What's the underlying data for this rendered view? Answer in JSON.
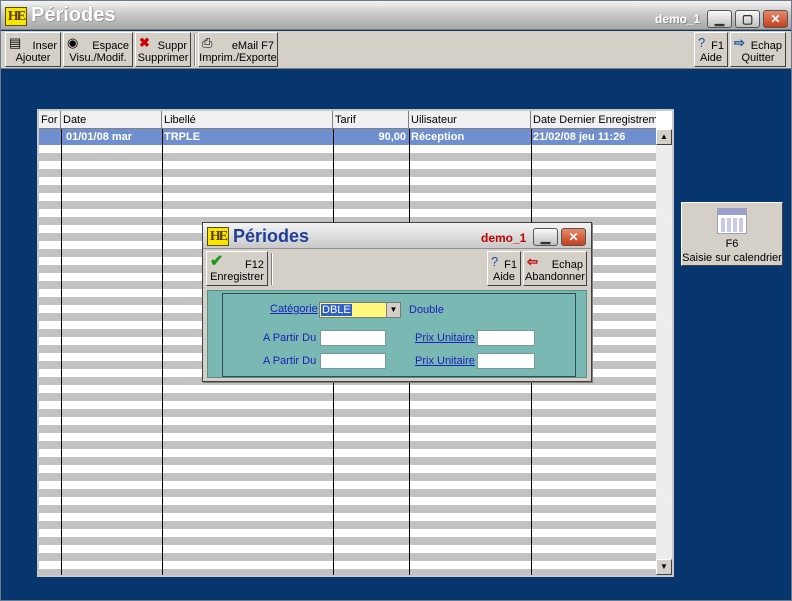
{
  "window": {
    "title": "Périodes",
    "user": "demo_1",
    "logo_text": "HE"
  },
  "toolbar": {
    "inser_key": "Inser",
    "inser_label": "Ajouter",
    "espace_key": "Espace",
    "espace_label": "Visu./Modif.",
    "suppr_key": "Suppr",
    "suppr_label": "Supprimer",
    "email_key": "eMail  F7",
    "email_label": "Imprim./Exporte",
    "aide_key": "F1",
    "aide_label": "Aide",
    "quit_key": "Echap",
    "quit_label": "Quitter"
  },
  "grid": {
    "columns": [
      "For",
      "Date",
      "Libellé",
      "Tarif",
      "Uilisateur",
      "Date Dernier Enregistrem"
    ],
    "rows": [
      {
        "for": "",
        "date": "01/01/08 mar",
        "libelle": "TRPLE",
        "tarif": "90,00",
        "utilisateur": "Réception",
        "date_dernier": "21/02/08 jeu 11:26"
      }
    ]
  },
  "calendar_button": {
    "key": "F6",
    "label": "Saisie sur calendrier"
  },
  "dialog": {
    "title": "Périodes",
    "user": "demo_1",
    "save_key": "F12",
    "save_label": "Enregistrer",
    "help_key": "F1",
    "help_label": "Aide",
    "cancel_key": "Echap",
    "cancel_label": "Abandonner",
    "category_label": "Catégorie",
    "category_value": "DBLE",
    "category_desc": "Double",
    "from_label_1": "A Partir Du",
    "from_label_2": "A Partir Du",
    "price_label_1": "Prix Unitaire",
    "price_label_2": "Prix Unitaire",
    "from_value_1": "",
    "from_value_2": "",
    "price_value_1": "",
    "price_value_2": ""
  },
  "colors": {
    "desktop": "#07366e",
    "selected_row": "#6f8fce",
    "form_panel": "#7ab8b4",
    "dialog_title": "#1f3f97",
    "user_red": "#c00000"
  }
}
